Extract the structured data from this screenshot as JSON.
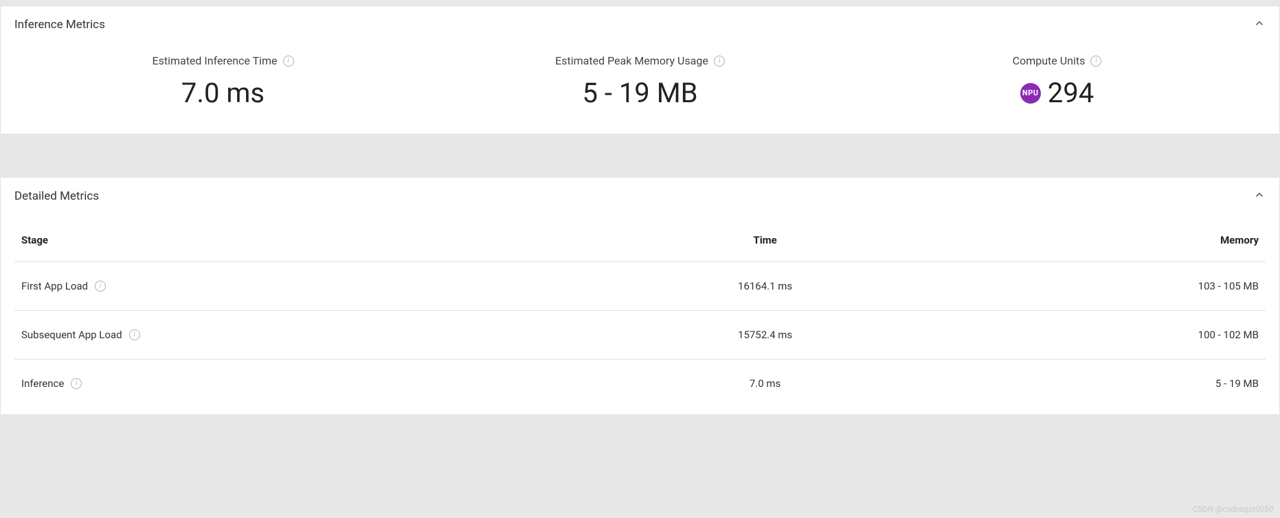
{
  "inference_panel": {
    "title": "Inference Metrics",
    "metrics": {
      "time": {
        "label": "Estimated Inference Time",
        "value": "7.0 ms"
      },
      "memory": {
        "label": "Estimated Peak Memory Usage",
        "value": "5 - 19 MB"
      },
      "units": {
        "label": "Compute Units",
        "badge": "NPU",
        "value": "294"
      }
    }
  },
  "detailed_panel": {
    "title": "Detailed Metrics",
    "columns": {
      "stage": "Stage",
      "time": "Time",
      "memory": "Memory"
    },
    "rows": [
      {
        "stage": "First App Load",
        "time": "16164.1 ms",
        "memory": "103 - 105 MB"
      },
      {
        "stage": "Subsequent App Load",
        "time": "15752.4 ms",
        "memory": "100 - 102 MB"
      },
      {
        "stage": "Inference",
        "time": "7.0 ms",
        "memory": "5 - 19 MB"
      }
    ]
  },
  "watermark": "CSDN @csdnsqst0050"
}
